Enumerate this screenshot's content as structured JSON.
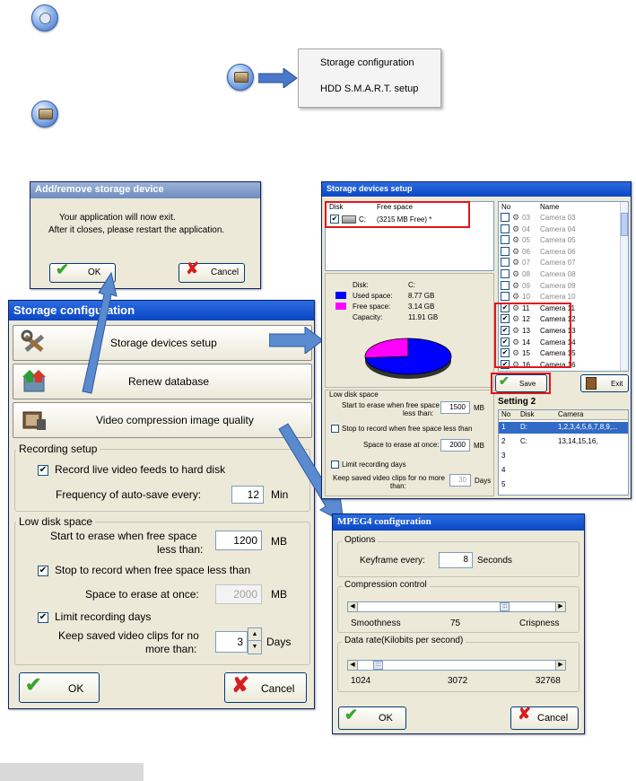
{
  "context_menu": {
    "items": [
      "Storage configuration",
      "HDD S.M.A.R.T. setup"
    ]
  },
  "add_remove_dialog": {
    "title": "Add/remove storage device",
    "message_line1": "Your application will now exit.",
    "message_line2": "After it closes, please restart the application.",
    "ok_label": "OK",
    "cancel_label": "Cancel"
  },
  "storage_config": {
    "title": "Storage configuration",
    "storage_devices_setup": "Storage devices setup",
    "renew_database": "Renew database",
    "video_compression": "Video compression image quality",
    "recording_setup": {
      "legend": "Recording setup",
      "record_live": "Record live video feeds to hard disk",
      "record_live_checked": true,
      "autosave_label": "Frequency of auto-save every:",
      "autosave_value": "12",
      "autosave_unit": "Min"
    },
    "low_disk": {
      "legend": "Low disk space",
      "erase_label_1": "Start to erase when free space",
      "erase_label_2": "less than:",
      "erase_value": "1200",
      "erase_unit": "MB",
      "stop_label": "Stop to record when free space less than",
      "stop_checked": true,
      "erase_once_label": "Space to erase at once:",
      "erase_once_value": "2000",
      "erase_once_unit": "MB",
      "limit_label": "Limit recording days",
      "limit_checked": true,
      "keep_label_1": "Keep saved video clips for no",
      "keep_label_2": "more than:",
      "keep_value": "3",
      "keep_unit": "Days"
    },
    "ok_label": "OK",
    "cancel_label": "Cancel"
  },
  "storage_devices_setup_win": {
    "title": "Storage devices setup",
    "disk_col": "Disk",
    "free_col": "Free space",
    "disk_row": {
      "drive": "C:",
      "free": "(3215 MB Free) *"
    },
    "disk_info": {
      "disk_label": "Disk:",
      "disk_value": "C:",
      "used_label": "Used space:",
      "used_value": "8.77 GB",
      "free_label": "Free space:",
      "free_value": "3.14 GB",
      "cap_label": "Capacity:",
      "cap_value": "11.91 GB"
    },
    "pie": {
      "used_fraction": 0.736,
      "used_color": "#0000ff",
      "free_color": "#ff00ff"
    },
    "camera_list": {
      "col_no": "No",
      "col_name": "Name",
      "rows": [
        {
          "no": "03",
          "name": "Camera 03",
          "checked": false
        },
        {
          "no": "04",
          "name": "Camera 04",
          "checked": false
        },
        {
          "no": "05",
          "name": "Camera 05",
          "checked": false
        },
        {
          "no": "06",
          "name": "Camera 06",
          "checked": false
        },
        {
          "no": "07",
          "name": "Camera 07",
          "checked": false
        },
        {
          "no": "08",
          "name": "Camera 08",
          "checked": false
        },
        {
          "no": "09",
          "name": "Camera 09",
          "checked": false
        },
        {
          "no": "10",
          "name": "Camera 10",
          "checked": false
        },
        {
          "no": "11",
          "name": "Camera 11",
          "checked": true
        },
        {
          "no": "12",
          "name": "Camera 12",
          "checked": true
        },
        {
          "no": "13",
          "name": "Camera 13",
          "checked": true
        },
        {
          "no": "14",
          "name": "Camera 14",
          "checked": true
        },
        {
          "no": "15",
          "name": "Camera 15",
          "checked": true
        },
        {
          "no": "16",
          "name": "Camera 16",
          "checked": true
        }
      ]
    },
    "save_label": "Save",
    "exit_label": "Exit",
    "low_disk_legend": "Low disk space",
    "erase_1": "Start to erase when free space",
    "erase_2": "less than:",
    "erase_value": "1500",
    "unit_mb": "MB",
    "stop_label": "Stop to record when free space less than",
    "erase_once": "Space to erase at once:",
    "erase_once_value": "2000",
    "limit_label": "Limit recording days",
    "keep_1": "Keep saved video clips for no more",
    "keep_2": "than:",
    "keep_value": "30",
    "keep_unit": "Days",
    "setting_title": "Setting 2",
    "setting_cols": [
      "No",
      "Disk",
      "Camera"
    ],
    "setting_rows": [
      {
        "no": "1",
        "disk": "D:",
        "camera": "1,2,3,4,5,6,7,8,9,..."
      },
      {
        "no": "2",
        "disk": "C:",
        "camera": "13,14,15,16,"
      },
      {
        "no": "3",
        "disk": "",
        "camera": ""
      },
      {
        "no": "4",
        "disk": "",
        "camera": ""
      },
      {
        "no": "5",
        "disk": "",
        "camera": ""
      }
    ]
  },
  "mpeg4": {
    "title": "MPEG4 configuration",
    "options_legend": "Options",
    "keyframe_label": "Keyframe every:",
    "keyframe_value": "8",
    "keyframe_unit": "Seconds",
    "compression_legend": "Compression control",
    "smoothness": "Smoothness",
    "compression_value": "75",
    "crispness": "Crispness",
    "compression_level": 0.75,
    "datarate_legend": "Data rate(Kilobits per second)",
    "dr_min": "1024",
    "dr_mid": "3072",
    "dr_max": "32768",
    "ok_label": "OK",
    "cancel_label": "Cancel"
  }
}
